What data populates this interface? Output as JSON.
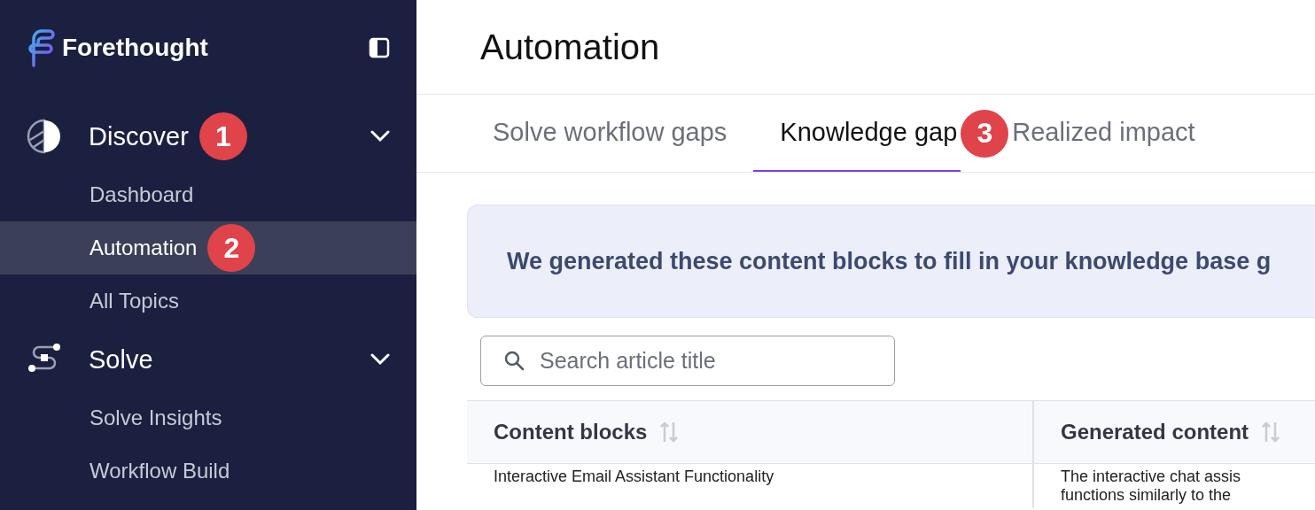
{
  "sidebar": {
    "brand": "Forethought",
    "sections": [
      {
        "label": "Discover",
        "badge": "1",
        "expanded": true,
        "items": [
          {
            "label": "Dashboard",
            "selected": false
          },
          {
            "label": "Automation",
            "selected": true,
            "badge": "2"
          },
          {
            "label": "All Topics",
            "selected": false
          }
        ]
      },
      {
        "label": "Solve",
        "expanded": true,
        "items": [
          {
            "label": "Solve Insights",
            "selected": false
          },
          {
            "label": "Workflow Build",
            "selected": false
          }
        ]
      }
    ]
  },
  "page": {
    "title": "Automation"
  },
  "tabs": [
    {
      "label": "Solve workflow gaps",
      "selected": false
    },
    {
      "label": "Knowledge gap",
      "selected": true,
      "badge": "3"
    },
    {
      "label": "Realized impact",
      "selected": false
    }
  ],
  "banner": {
    "text": "We generated these content blocks to fill in your knowledge base g"
  },
  "search": {
    "placeholder": "Search article title"
  },
  "table": {
    "columns": [
      "Content blocks",
      "Generated content"
    ],
    "rows": [
      {
        "content_block": "Interactive Email Assistant Functionality",
        "generated_content": [
          "The interactive chat assis",
          "functions similarly to the"
        ]
      }
    ]
  }
}
